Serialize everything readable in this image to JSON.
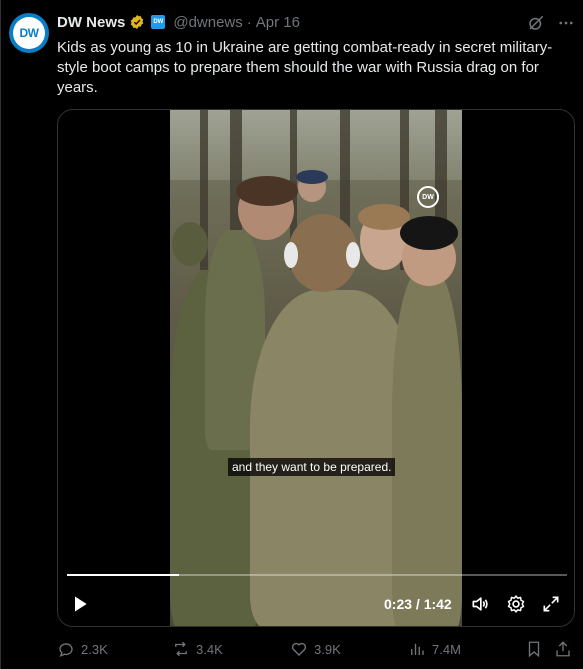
{
  "author": {
    "name": "DW News",
    "handle": "@dwnews",
    "separator": "·",
    "date": "Apr 16",
    "avatar_text": "DW",
    "affiliate_badge_text": "DW"
  },
  "tweet": {
    "text": "Kids as young as 10 in Ukraine are getting combat-ready in secret military-style boot camps to prepare them should the war with Russia drag on for years."
  },
  "video": {
    "watermark": "DW",
    "subtitle": "and they want to be prepared.",
    "time": "0:23 / 1:42",
    "progress_fraction": 0.224
  },
  "actions": {
    "replies": "2.3K",
    "reposts": "3.4K",
    "likes": "3.9K",
    "views": "7.4M"
  },
  "colors": {
    "background": "#000000",
    "text": "#e7e9ea",
    "muted": "#71767b",
    "border": "#2f3336",
    "verified_gold": "#e2b719",
    "affiliate_blue": "#1d9bf0"
  },
  "icons": [
    "grok-icon",
    "more-icon",
    "play-icon",
    "volume-icon",
    "gear-icon",
    "expand-icon",
    "reply-icon",
    "repost-icon",
    "like-icon",
    "views-icon",
    "bookmark-icon",
    "share-icon",
    "verified-icon"
  ]
}
